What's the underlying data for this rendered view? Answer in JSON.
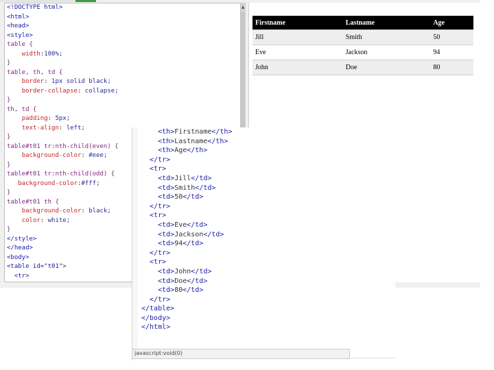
{
  "editor": {
    "html_lines": [
      "<!DOCTYPE html>",
      "<html>",
      "<head>",
      "<style>",
      "table {",
      "    width:100%;",
      "}",
      "table, th, td {",
      "    border: 1px solid black;",
      "    border-collapse: collapse;",
      "}",
      "th, td {",
      "    padding: 5px;",
      "    text-align: left;",
      "}",
      "table#t01 tr:nth-child(even) {",
      "    background-color: #eee;",
      "}",
      "table#t01 tr:nth-child(odd) {",
      "   background-color:#fff;",
      "}",
      "table#t01 th {",
      "    background-color: black;",
      "    color: white;",
      "}",
      "</style>",
      "</head>",
      "<body>",
      "<table id=\"t01\">",
      "  <tr>"
    ],
    "table_lines": [
      "    <th>Firstname</th>",
      "    <th>Lastname</th>",
      "    <th>Age</th>",
      "  </tr>",
      "  <tr>",
      "    <td>Jill</td>",
      "    <td>Smith</td>",
      "    <td>50</td>",
      "  </tr>",
      "  <tr>",
      "    <td>Eve</td>",
      "    <td>Jackson</td>",
      "    <td>94</td>",
      "  </tr>",
      "  <tr>",
      "    <td>John</td>",
      "    <td>Doe</td>",
      "    <td>80</td>",
      "  </tr>",
      "</table>",
      "</body>",
      "</html>"
    ]
  },
  "result": {
    "headers": [
      "Firstname",
      "Lastname",
      "Age"
    ],
    "rows": [
      [
        "Jill",
        "Smith",
        "50"
      ],
      [
        "Eve",
        "Jackson",
        "94"
      ],
      [
        "John",
        "Doe",
        "80"
      ]
    ]
  },
  "status_bar": {
    "text": "javascript:void(0)"
  },
  "colors": {
    "header_bg": "#000000",
    "header_fg": "#ffffff",
    "even_row": "#eeeeee",
    "odd_row": "#ffffff",
    "tab_accent": "#3e9a4b"
  }
}
